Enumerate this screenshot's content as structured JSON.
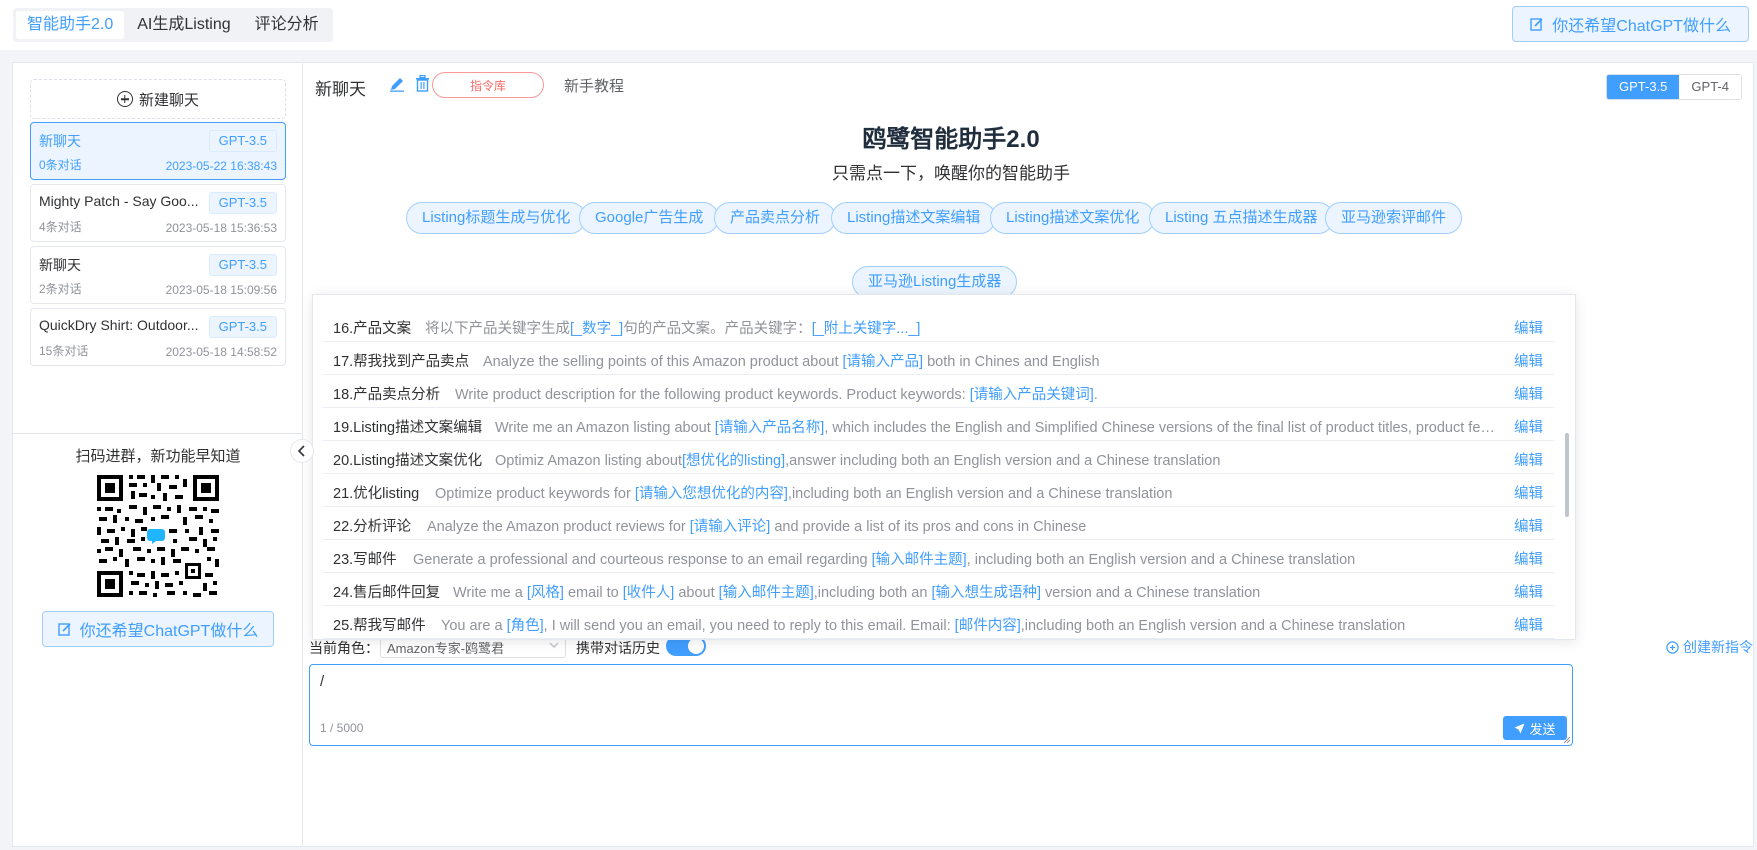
{
  "topbar": {
    "tabs": [
      {
        "label": "智能助手2.0",
        "active": true
      },
      {
        "label": "AI生成Listing",
        "active": false
      },
      {
        "label": "评论分析",
        "active": false
      }
    ],
    "wish_button": "你还希望ChatGPT做什么"
  },
  "sidebar": {
    "new_chat_label": "新建聊天",
    "chats": [
      {
        "title": "新聊天",
        "badge": "GPT-3.5",
        "count": "0条对话",
        "time": "2023-05-22 16:38:43",
        "active": true
      },
      {
        "title": "Mighty Patch - Say Goo...",
        "badge": "GPT-3.5",
        "count": "4条对话",
        "time": "2023-05-18 15:36:53",
        "active": false
      },
      {
        "title": "新聊天",
        "badge": "GPT-3.5",
        "count": "2条对话",
        "time": "2023-05-18 15:09:56",
        "active": false
      },
      {
        "title": "QuickDry Shirt: Outdoor...",
        "badge": "GPT-3.5",
        "count": "15条对话",
        "time": "2023-05-18 14:58:52",
        "active": false
      }
    ],
    "qr_caption": "扫码进群，新功能早知道",
    "wish_button": "你还希望ChatGPT做什么"
  },
  "chat": {
    "title": "新聊天",
    "command_library_label": "指令库",
    "tutorial_label": "新手教程",
    "models": [
      {
        "label": "GPT-3.5",
        "active": true
      },
      {
        "label": "GPT-4",
        "active": false
      }
    ],
    "hero_title": "鸥鹭智能助手2.0",
    "hero_subtitle": "只需点一下，唤醒你的智能助手",
    "chips": [
      "Listing标题生成与优化",
      "Google广告生成",
      "产品卖点分析",
      "Listing描述文案编辑",
      "Listing描述文案优化",
      "Listing 五点描述生成器",
      "亚马逊索评邮件",
      "亚马逊Listing生成器"
    ]
  },
  "commands": [
    {
      "name": "16.产品文案",
      "parts": [
        {
          "t": "将以下产品关键字生成"
        },
        {
          "t": "[_数字_]",
          "hl": true
        },
        {
          "t": "句的产品文案。产品关键字："
        },
        {
          "t": "[_附上关键字..._]",
          "hl": true
        }
      ],
      "edit": "编辑"
    },
    {
      "name": "17.帮我找到产品卖点",
      "parts": [
        {
          "t": "Analyze the selling points of this Amazon product about "
        },
        {
          "t": "[请输入产品]",
          "hl": true
        },
        {
          "t": " both in Chines and English"
        }
      ],
      "edit": "编辑"
    },
    {
      "name": "18.产品卖点分析",
      "parts": [
        {
          "t": "Write product description for the following product keywords. Product keywords: "
        },
        {
          "t": "[请输入产品关键词]",
          "hl": true
        },
        {
          "t": "."
        }
      ],
      "edit": "编辑"
    },
    {
      "name": "19.Listing描述文案编辑",
      "parts": [
        {
          "t": "Write me an Amazon listing about "
        },
        {
          "t": "[请输入产品名称]",
          "hl": true
        },
        {
          "t": ", which includes the English and Simplified Chinese versions of the final list of product titles, product features, p..."
        }
      ],
      "edit": "编辑"
    },
    {
      "name": "20.Listing描述文案优化",
      "parts": [
        {
          "t": "Optimiz Amazon listing about"
        },
        {
          "t": "[想优化的listing]",
          "hl": true
        },
        {
          "t": ",answer including both an English version and a Chinese translation"
        }
      ],
      "edit": "编辑"
    },
    {
      "name": "21.优化listing",
      "parts": [
        {
          "t": "Optimize product keywords for "
        },
        {
          "t": "[请输入您想优化的内容]",
          "hl": true
        },
        {
          "t": ",including both an English version and a Chinese translation"
        }
      ],
      "edit": "编辑"
    },
    {
      "name": "22.分析评论",
      "parts": [
        {
          "t": "Analyze the Amazon product reviews for "
        },
        {
          "t": "[请输入评论]",
          "hl": true
        },
        {
          "t": " and provide a list of its pros and cons in Chinese"
        }
      ],
      "edit": "编辑"
    },
    {
      "name": "23.写邮件",
      "parts": [
        {
          "t": "Generate a professional and courteous response to an email regarding "
        },
        {
          "t": "[输入邮件主题]",
          "hl": true
        },
        {
          "t": ", including both an English version and a Chinese translation"
        }
      ],
      "edit": "编辑"
    },
    {
      "name": "24.售后邮件回复",
      "parts": [
        {
          "t": "Write me a "
        },
        {
          "t": "[风格]",
          "hl": true
        },
        {
          "t": " email to "
        },
        {
          "t": "[收件人]",
          "hl": true
        },
        {
          "t": " about "
        },
        {
          "t": "[输入邮件主题]",
          "hl": true
        },
        {
          "t": ",including both an "
        },
        {
          "t": "[输入想生成语种]",
          "hl": true
        },
        {
          "t": " version and a Chinese translation"
        }
      ],
      "edit": "编辑"
    },
    {
      "name": "25.帮我写邮件",
      "parts": [
        {
          "t": "You are a "
        },
        {
          "t": "[角色]",
          "hl": true
        },
        {
          "t": ", I will send you an email, you need to reply to this email. Email: "
        },
        {
          "t": "[邮件内容]",
          "hl": true
        },
        {
          "t": ",including both an English version and a Chinese translation"
        }
      ],
      "edit": "编辑"
    }
  ],
  "options": {
    "role_label": "当前角色：",
    "role_value": "Amazon专家-鸥鹭君",
    "history_label": "携带对话历史",
    "history_on": true,
    "create_command_label": "创建新指令"
  },
  "input": {
    "value": "/",
    "counter": "1 / 5000",
    "send_label": "发送"
  },
  "colors": {
    "accent": "#409eff",
    "danger": "#f56c6c",
    "border": "#e4e7ed"
  }
}
